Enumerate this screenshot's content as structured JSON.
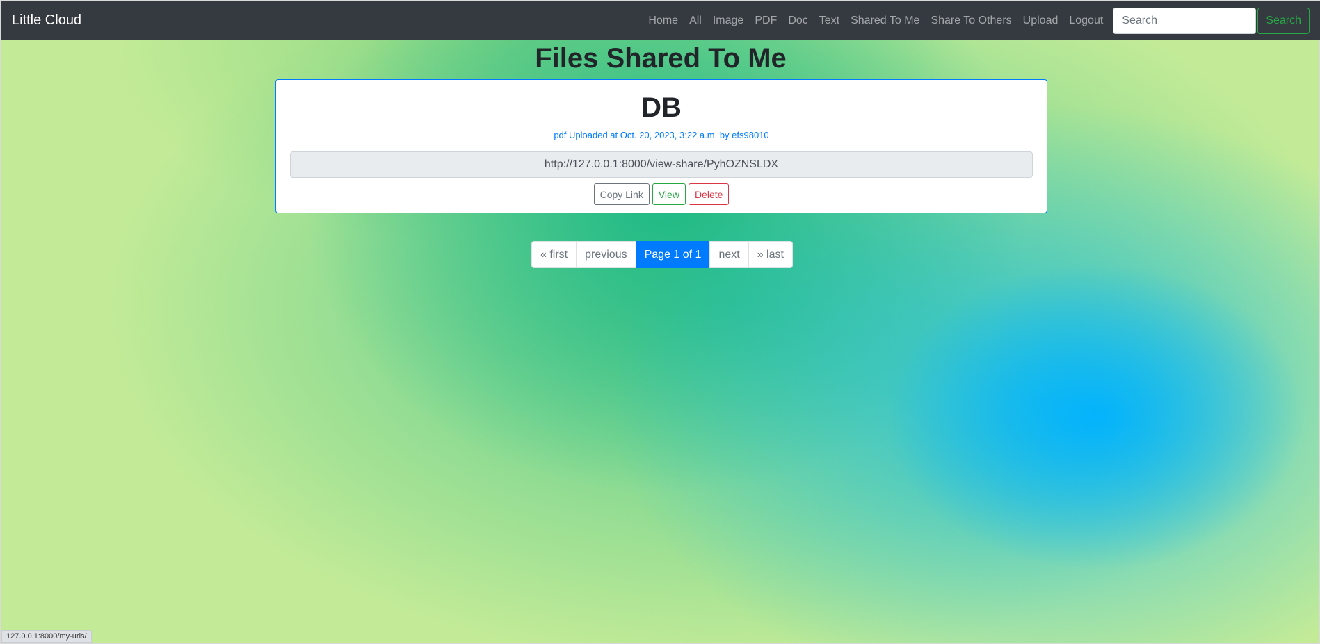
{
  "navbar": {
    "brand": "Little Cloud",
    "links": [
      "Home",
      "All",
      "Image",
      "PDF",
      "Doc",
      "Text",
      "Shared To Me",
      "Share To Others",
      "Upload",
      "Logout"
    ],
    "search_placeholder": "Search",
    "search_button": "Search"
  },
  "page": {
    "title": "Files Shared To Me"
  },
  "files": [
    {
      "name": "DB",
      "meta": "pdf Uploaded at Oct. 20, 2023, 3:22 a.m. by efs98010",
      "share_url": "http://127.0.0.1:8000/view-share/PyhOZNSLDX",
      "buttons": {
        "copy": "Copy Link",
        "view": "View",
        "delete": "Delete"
      }
    }
  ],
  "pagination": {
    "first": "« first",
    "previous": "previous",
    "current": "Page 1 of 1",
    "next": "next",
    "last": "» last"
  },
  "status_bar": {
    "url": "127.0.0.1:8000/my-urls/"
  },
  "colors": {
    "navbar_bg": "#343a40",
    "primary": "#007bff",
    "success": "#28a745",
    "danger": "#dc3545",
    "secondary": "#6c757d"
  }
}
